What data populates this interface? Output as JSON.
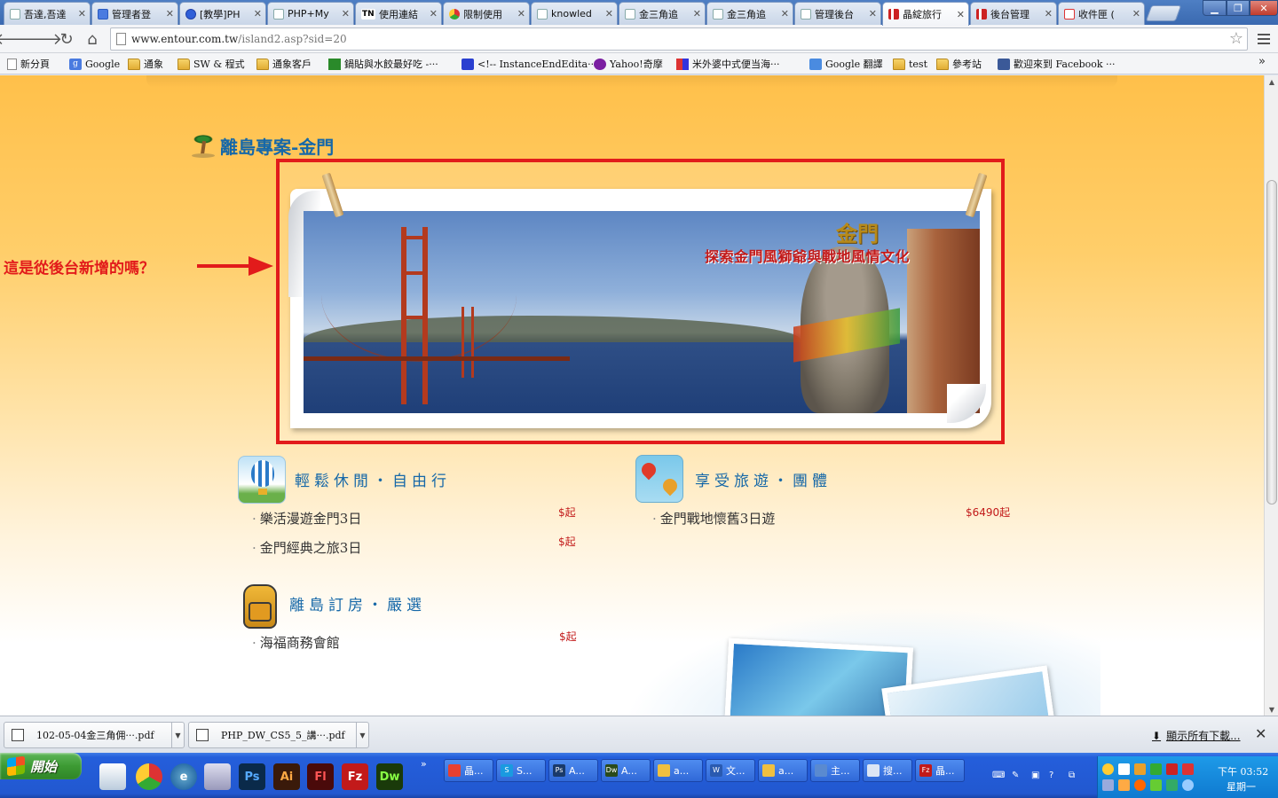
{
  "browser": {
    "tabs": [
      {
        "label": "吾達,吾達",
        "icon": "page"
      },
      {
        "label": "管理者登",
        "icon": "g"
      },
      {
        "label": "[教學]PH",
        "icon": "chat"
      },
      {
        "label": "PHP+My",
        "icon": "page"
      },
      {
        "label": "使用連結",
        "icon": "tn",
        "prefix": "TN"
      },
      {
        "label": "限制使用",
        "icon": "chrome"
      },
      {
        "label": "knowled",
        "icon": "page"
      },
      {
        "label": "金三角追",
        "icon": "page"
      },
      {
        "label": "金三角追",
        "icon": "page"
      },
      {
        "label": "管理後台",
        "icon": "page"
      },
      {
        "label": "晶綻旅行",
        "icon": "red",
        "active": true
      },
      {
        "label": "後台管理",
        "icon": "red"
      },
      {
        "label": "收件匣 (",
        "icon": "gm"
      }
    ],
    "url_host": "www.entour.com.tw",
    "url_path": "/island2.asp?sid=20",
    "bookmarks": [
      {
        "label": "新分頁",
        "icon": "page"
      },
      {
        "label": "Google",
        "icon": "g"
      },
      {
        "label": "通象",
        "icon": "folder"
      },
      {
        "label": "SW & 程式",
        "icon": "folder"
      },
      {
        "label": "通象客戶",
        "icon": "folder"
      },
      {
        "label": "鍋貼與水餃最好吃 -···",
        "icon": "green"
      },
      {
        "label": "<!-- InstanceEndEdita···",
        "icon": "paw"
      },
      {
        "label": "Yahoo!奇摩",
        "icon": "yahoo"
      },
      {
        "label": "米外婆中式便当海···",
        "icon": "mi"
      },
      {
        "label": "Google 翻譯",
        "icon": "gt"
      },
      {
        "label": "test",
        "icon": "folder"
      },
      {
        "label": "參考站",
        "icon": "folder"
      },
      {
        "label": "歡迎來到 Facebook ···",
        "icon": "fb"
      }
    ],
    "bookmarks_more": "»"
  },
  "page": {
    "section_title": "離島專案-金門",
    "banner_heading": "金門",
    "banner_subtitle": "探索金門風獅爺與戰地風情文化",
    "annotation": "這是從後台新增的嗎？",
    "categories": [
      {
        "title": "輕鬆休閒・自由行",
        "icon": "hot-air-balloon-icon",
        "items": [
          {
            "name": "樂活漫遊金門3日",
            "price": "$起"
          },
          {
            "name": "金門經典之旅3日",
            "price": "$起"
          }
        ]
      },
      {
        "title": "享受旅遊・團體",
        "icon": "map-pin-icon",
        "items": [
          {
            "name": "金門戰地懷舊3日遊",
            "price": "$6490起"
          }
        ]
      },
      {
        "title": "離島訂房・嚴選",
        "icon": "backpack-icon",
        "items": [
          {
            "name": "海福商務會館",
            "price": "$起"
          }
        ]
      }
    ],
    "dot": "·"
  },
  "downloads": {
    "items": [
      {
        "name": "102-05-04金三角佣···.pdf"
      },
      {
        "name": "PHP_DW_CS5_5_講···.pdf"
      }
    ],
    "show_all": "顯示所有下載..."
  },
  "taskbar": {
    "start_label": "開始",
    "tasks": [
      {
        "label": "晶...",
        "color": "#e84030"
      },
      {
        "label": "S...",
        "color": "#1a9ae0",
        "glyph": "S"
      },
      {
        "label": "A...",
        "color": "#1a3a6a",
        "glyph": "Ps"
      },
      {
        "label": "A...",
        "color": "#2a4a1a",
        "glyph": "Dw"
      },
      {
        "label": "a...",
        "color": "#f0c040"
      },
      {
        "label": "文...",
        "color": "#2a5ab0",
        "glyph": "W"
      },
      {
        "label": "a...",
        "color": "#f0c040"
      },
      {
        "label": "主...",
        "color": "#5a8ad0"
      },
      {
        "label": "搜...",
        "color": "#dde6f4"
      },
      {
        "label": "晶...",
        "color": "#c21a1a",
        "glyph": "Fz"
      }
    ],
    "clock_time": "下午 03:52",
    "clock_day": "星期一"
  },
  "colors": {
    "annotation_red": "#e21b1b",
    "title_blue": "#1668a8",
    "price_red": "#c21a1a"
  }
}
